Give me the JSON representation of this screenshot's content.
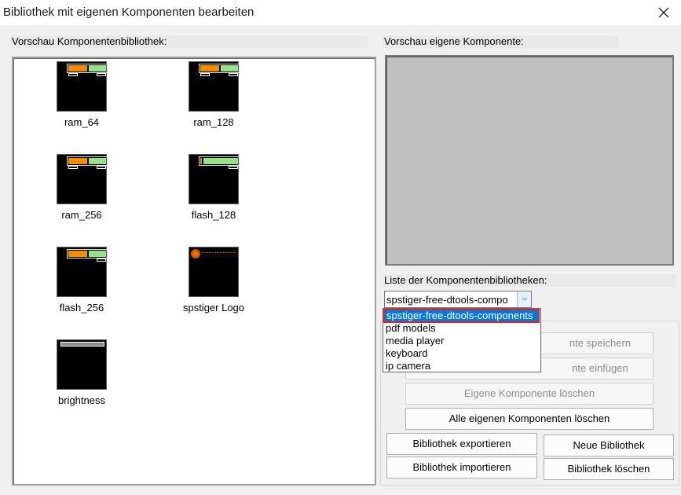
{
  "window": {
    "title": "Bibliothek mit eigenen Komponenten bearbeiten",
    "close_icon": "close-icon"
  },
  "labels": {
    "library_preview": "Vorschau Komponentenbibliothek:",
    "own_preview": "Vorschau eigene Komponente:",
    "library_list": "Liste der Komponentenbibliotheken:"
  },
  "library_items": [
    {
      "name": "ram_64",
      "icon": "ram-thumbnail"
    },
    {
      "name": "ram_128",
      "icon": "ram-thumbnail"
    },
    {
      "name": "ram_256",
      "icon": "ram-thumbnail"
    },
    {
      "name": "flash_128",
      "icon": "flash-thumbnail"
    },
    {
      "name": "flash_256",
      "icon": "flash-thumbnail"
    },
    {
      "name": "spstiger Logo",
      "icon": "logo-thumbnail"
    },
    {
      "name": "brightness",
      "icon": "brightness-thumbnail"
    }
  ],
  "combo": {
    "value": "spstiger-free-dtools-compo",
    "options": [
      "spstiger-free-dtools-components",
      "pdf models",
      "media player",
      "keyboard",
      "ip camera"
    ],
    "selected_index": 0
  },
  "buttons": {
    "save_partial": "nte speichern",
    "insert_partial": "nte einfügen",
    "delete_own": "Eigene Komponente löschen",
    "delete_all_own": "Alle eigenen Komponenten löschen",
    "export": "Bibliothek exportieren",
    "new_library": "Neue Bibliothek",
    "import": "Bibliothek importieren",
    "delete_library": "Bibliothek löschen"
  },
  "colors": {
    "selection": "#0078d7",
    "highlight_border": "#e0202e",
    "preview_bg": "#c0c0c0"
  }
}
